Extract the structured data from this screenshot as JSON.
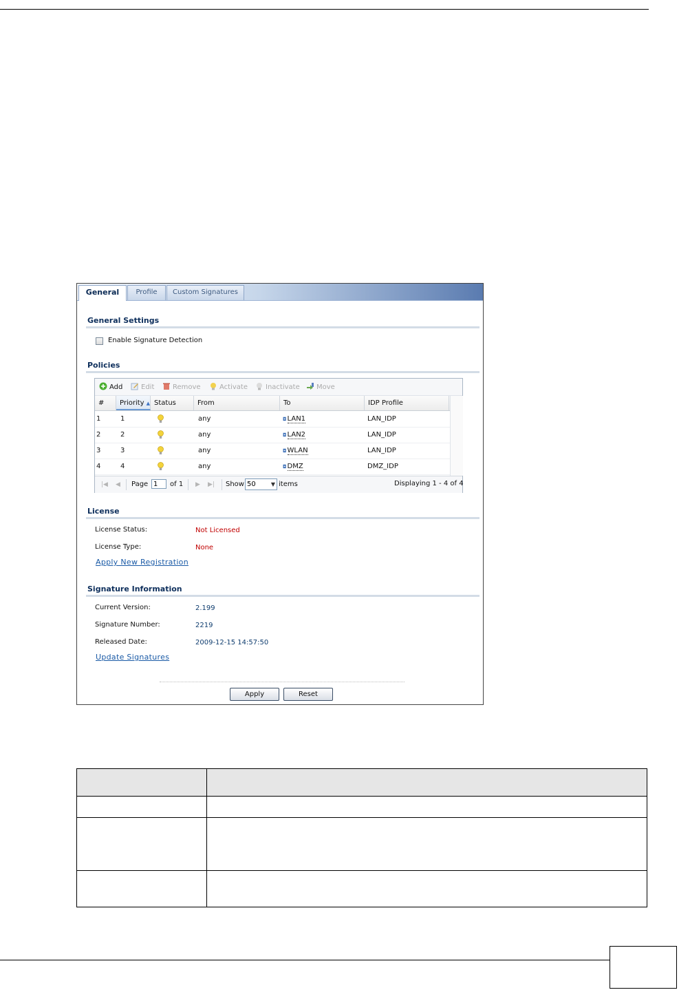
{
  "tabs": [
    {
      "label": "General",
      "active": true
    },
    {
      "label": "Profile",
      "active": false
    },
    {
      "label": "Custom Signatures",
      "active": false
    }
  ],
  "general_settings": {
    "title": "General Settings",
    "enable_label": "Enable Signature Detection",
    "enable_checked": false
  },
  "policies": {
    "title": "Policies",
    "toolbar": {
      "add": "Add",
      "edit": "Edit",
      "remove": "Remove",
      "activate": "Activate",
      "inactivate": "Inactivate",
      "move": "Move"
    },
    "columns": [
      "#",
      "Priority",
      "Status",
      "From",
      "To",
      "IDP Profile"
    ],
    "sort_column": "Priority",
    "sort_direction": "ascending",
    "rows": [
      {
        "num": "1",
        "priority": "1",
        "status": "active",
        "from": "any",
        "to": "LAN1",
        "profile": "LAN_IDP"
      },
      {
        "num": "2",
        "priority": "2",
        "status": "active",
        "from": "any",
        "to": "LAN2",
        "profile": "LAN_IDP"
      },
      {
        "num": "3",
        "priority": "3",
        "status": "active",
        "from": "any",
        "to": "WLAN",
        "profile": "LAN_IDP"
      },
      {
        "num": "4",
        "priority": "4",
        "status": "active",
        "from": "any",
        "to": "DMZ",
        "profile": "DMZ_IDP"
      }
    ],
    "pager": {
      "page_label": "Page",
      "page_value": "1",
      "of_label": "of 1",
      "show_label": "Show",
      "show_value": "50",
      "items_label": "items",
      "displaying": "Displaying 1 - 4 of 4"
    }
  },
  "license": {
    "title": "License",
    "status_label": "License Status:",
    "status_value": "Not Licensed",
    "type_label": "License Type:",
    "type_value": "None",
    "register_link": "Apply New Registration"
  },
  "signature": {
    "title": "Signature Information",
    "version_label": "Current Version:",
    "version_value": "2.199",
    "number_label": "Signature Number:",
    "number_value": "2219",
    "released_label": "Released Date:",
    "released_value": "2009-12-15 14:57:50",
    "update_link": "Update Signatures"
  },
  "buttons": {
    "apply": "Apply",
    "reset": "Reset"
  },
  "colors": {
    "section_title": "#0e2f5c",
    "link": "#1a5aa6",
    "unlicensed": "#c00000",
    "value": "#0e3c6e"
  }
}
